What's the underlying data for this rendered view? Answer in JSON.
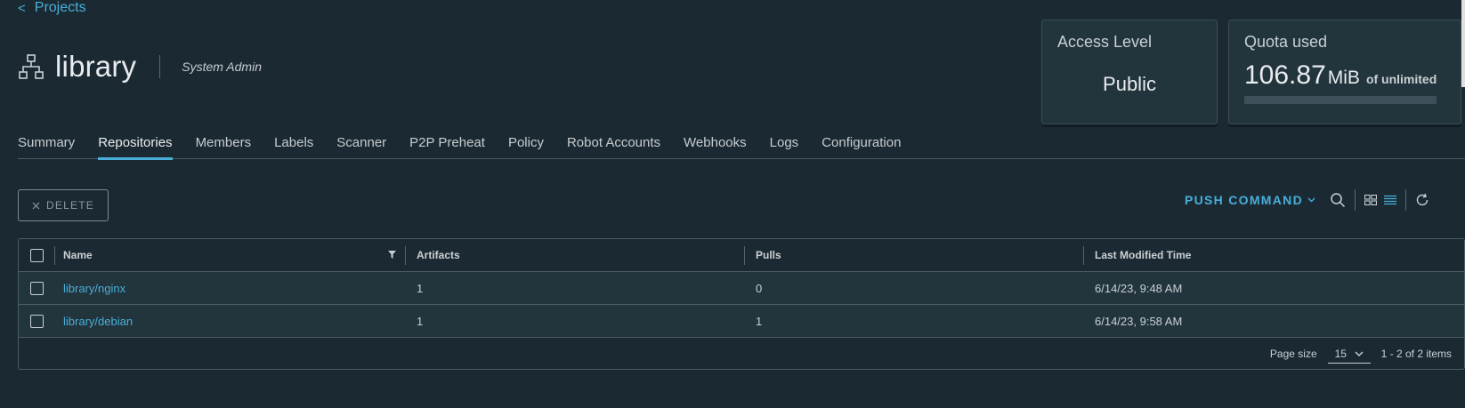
{
  "nav": {
    "back_label": "Projects",
    "back_chevron": "<"
  },
  "project": {
    "title": "library",
    "role": "System Admin",
    "icon": "project-hierarchy-icon"
  },
  "access_card": {
    "title": "Access Level",
    "value": "Public"
  },
  "quota_card": {
    "title": "Quota used",
    "amount": "106.87",
    "unit": "MiB",
    "limit_text": "of unlimited",
    "fill_fraction": 0
  },
  "tabs": [
    {
      "label": "Summary",
      "active": false
    },
    {
      "label": "Repositories",
      "active": true
    },
    {
      "label": "Members",
      "active": false
    },
    {
      "label": "Labels",
      "active": false
    },
    {
      "label": "Scanner",
      "active": false
    },
    {
      "label": "P2P Preheat",
      "active": false
    },
    {
      "label": "Policy",
      "active": false
    },
    {
      "label": "Robot Accounts",
      "active": false
    },
    {
      "label": "Webhooks",
      "active": false
    },
    {
      "label": "Logs",
      "active": false
    },
    {
      "label": "Configuration",
      "active": false
    }
  ],
  "toolbar": {
    "delete_label": "DELETE",
    "push_command_label": "PUSH COMMAND"
  },
  "table": {
    "columns": {
      "name": "Name",
      "artifacts": "Artifacts",
      "pulls": "Pulls",
      "modified": "Last Modified Time"
    },
    "rows": [
      {
        "name": "library/nginx",
        "artifacts": "1",
        "pulls": "0",
        "modified": "6/14/23, 9:48 AM"
      },
      {
        "name": "library/debian",
        "artifacts": "1",
        "pulls": "1",
        "modified": "6/14/23, 9:58 AM"
      }
    ],
    "footer": {
      "page_size_label": "Page size",
      "page_size_value": "15",
      "range_text": "1 - 2 of 2 items"
    }
  },
  "colors": {
    "background": "#1b2a32",
    "accent": "#49afd9",
    "card": "#22343c"
  }
}
